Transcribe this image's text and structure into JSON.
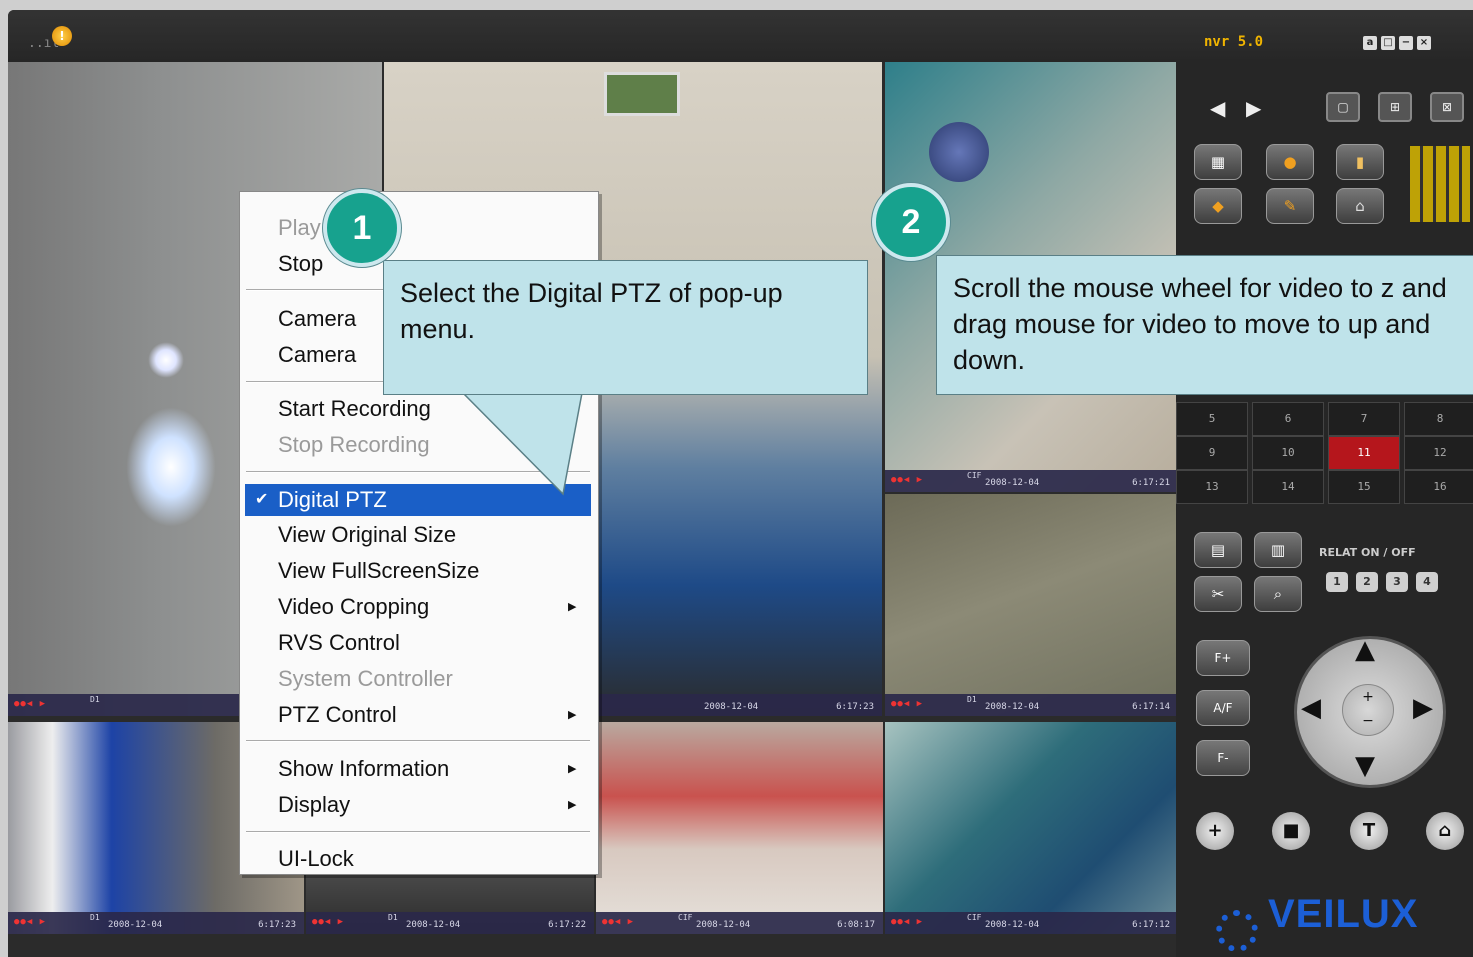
{
  "title_bar": {
    "signal": "..ıl",
    "alert_badge": "!",
    "brand": "nvr 5.0",
    "window_buttons": [
      "a",
      "□",
      "−",
      "×"
    ]
  },
  "tiles": [
    {
      "res": "D1",
      "date": "",
      "time": ""
    },
    {
      "res": "",
      "date": "2008-12-04",
      "time": "6:17:23"
    },
    {
      "res": "CIF",
      "date": "2008-12-04",
      "time": "6:17:21"
    },
    {
      "res": "D1",
      "date": "2008-12-04",
      "time": "6:17:14"
    },
    {
      "res": "D1",
      "date": "2008-12-04",
      "time": "6:17:23"
    },
    {
      "res": "D1",
      "date": "2008-12-04",
      "time": "6:17:22"
    },
    {
      "res": "CIF",
      "date": "2008-12-04",
      "time": "6:08:17"
    },
    {
      "res": "CIF",
      "date": "2008-12-04",
      "time": "6:17:12"
    }
  ],
  "panel": {
    "channels": [
      "5",
      "6",
      "7",
      "8",
      "9",
      "10",
      "11",
      "12",
      "13",
      "14",
      "15",
      "16"
    ],
    "active_channel": "11",
    "relay_label": "RELAT ON / OFF",
    "relay_buttons": [
      "1",
      "2",
      "3",
      "4"
    ],
    "focus_buttons": [
      "F+",
      "A/F",
      "F-"
    ],
    "logo": "VEILUX"
  },
  "context_menu": {
    "items": [
      {
        "label": "Play",
        "disabled": true
      },
      {
        "label": "Stop",
        "disabled": false
      },
      {
        "label": "Camera",
        "disabled": false
      },
      {
        "label": "Camera",
        "disabled": false
      },
      {
        "label": "Start Recording",
        "disabled": false
      },
      {
        "label": "Stop Recording",
        "disabled": true
      },
      {
        "label": "Digital PTZ",
        "checked": true
      },
      {
        "label": "View Original Size",
        "disabled": false
      },
      {
        "label": "View FullScreenSize",
        "disabled": false
      },
      {
        "label": "Video Cropping",
        "submenu": true
      },
      {
        "label": "RVS Control",
        "disabled": false
      },
      {
        "label": "System Controller",
        "disabled": true
      },
      {
        "label": "PTZ Control",
        "submenu": true
      },
      {
        "label": "Show Information",
        "submenu": true
      },
      {
        "label": "Display",
        "submenu": true
      },
      {
        "label": "UI-Lock",
        "disabled": false
      }
    ]
  },
  "callouts": [
    {
      "number": "1",
      "text": "Select the Digital PTZ of pop-up menu."
    },
    {
      "number": "2",
      "text": "Scroll the mouse wheel for video to z and  drag mouse for video to move to up and down."
    }
  ]
}
